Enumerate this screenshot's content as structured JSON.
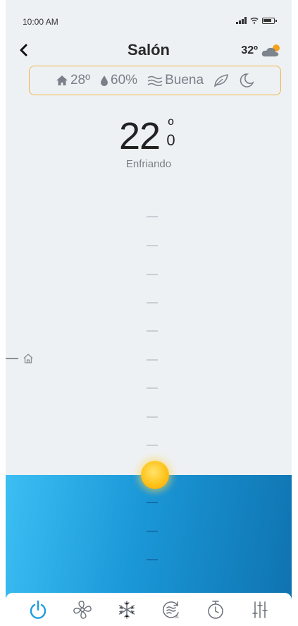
{
  "status_bar": {
    "time": "10:00 AM",
    "icons": [
      "signal-icon",
      "wifi-icon",
      "battery-icon"
    ]
  },
  "header": {
    "back_icon": "chevron-left-icon",
    "title": "Salón",
    "outdoor_temp": "32º",
    "weather_icon": "cloud-sun-icon"
  },
  "info_bar": {
    "indoor_temp": "28º",
    "humidity": "60%",
    "air_quality": "Buena",
    "eco_icon": "leaf-icon",
    "night_icon": "moon-icon"
  },
  "thermostat": {
    "setpoint": "22",
    "setpoint_unit": "º",
    "setpoint_decimal": "0",
    "mode_text": "Enfriando",
    "home_marker_icon": "home-icon",
    "fill_color": "#1b98d8",
    "knob_color": "#ffc21a"
  },
  "bottom_nav": [
    {
      "name": "power-icon",
      "color": "#1b9ee0"
    },
    {
      "name": "fan-icon",
      "color": "#6b7079"
    },
    {
      "name": "snowflake-icon",
      "color": "#6b7079"
    },
    {
      "name": "auto-airflow-icon",
      "color": "#6b7079"
    },
    {
      "name": "timer-icon",
      "color": "#6b7079"
    },
    {
      "name": "settings-sliders-icon",
      "color": "#6b7079"
    }
  ]
}
